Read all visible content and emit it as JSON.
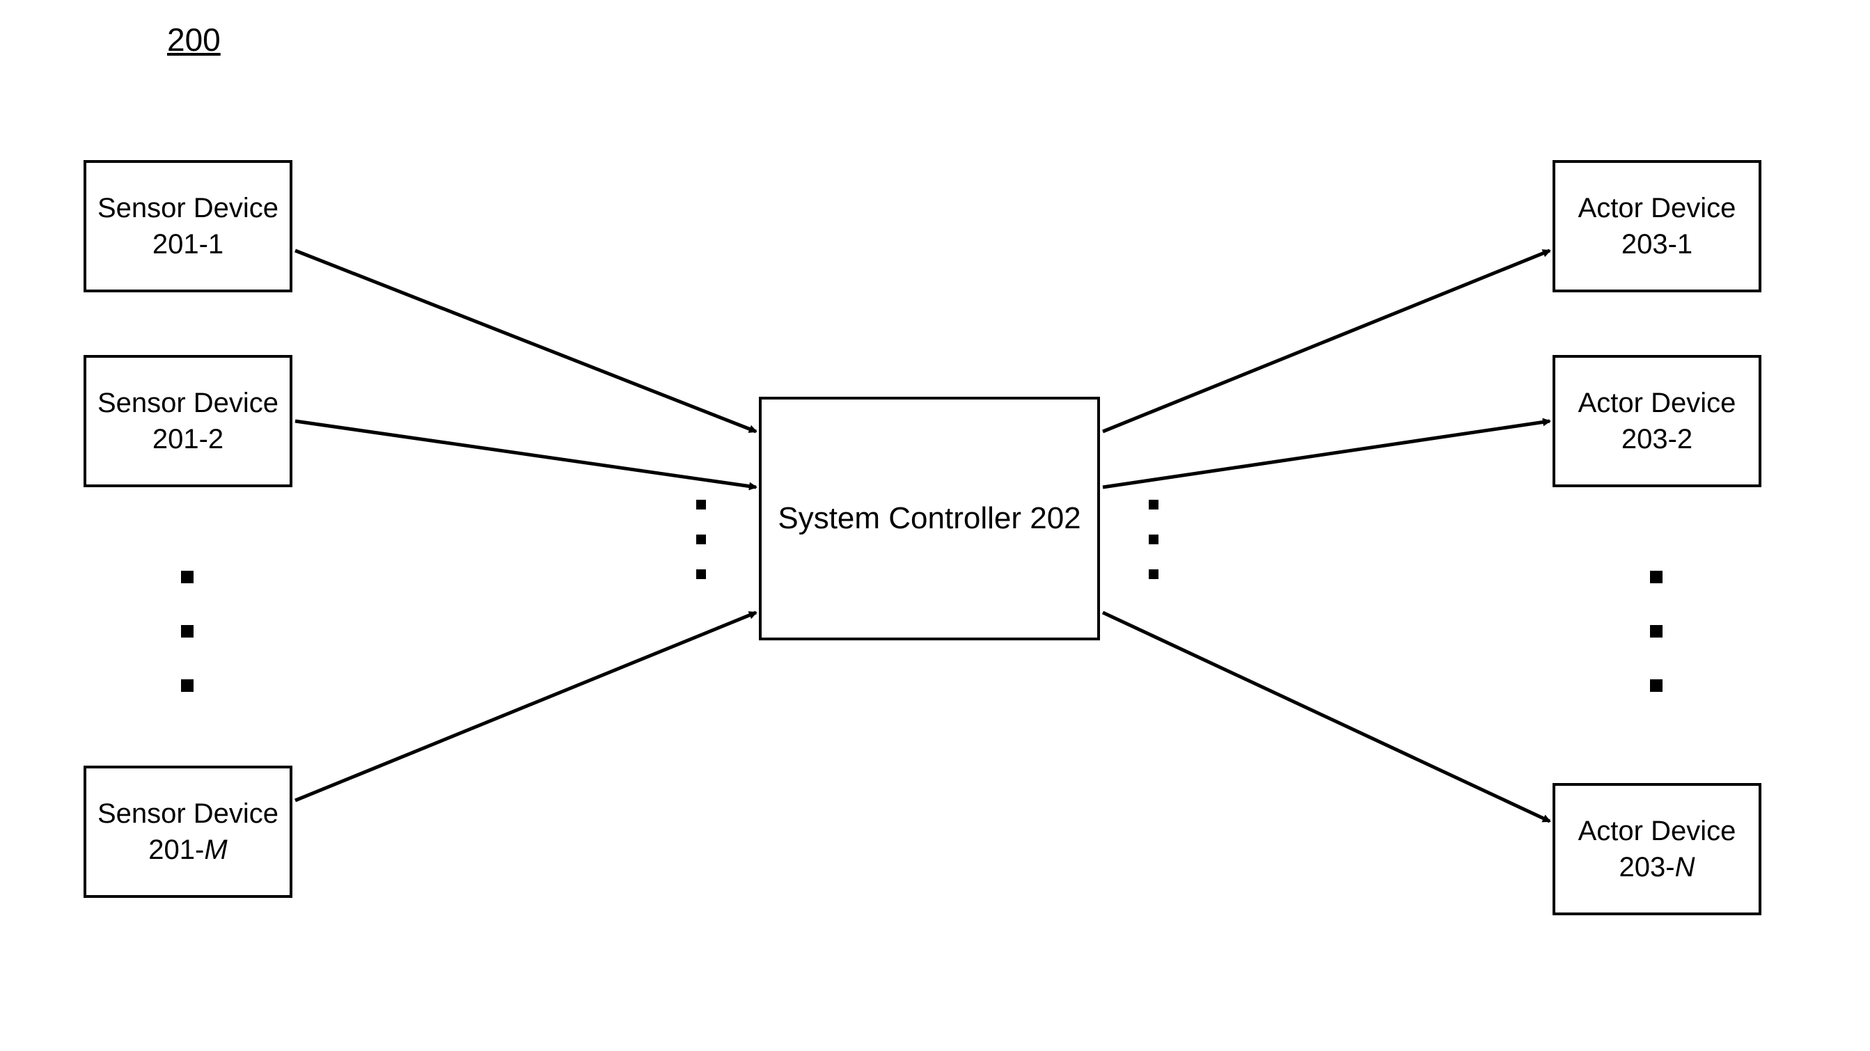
{
  "figure_number": "200",
  "sensors": {
    "box1": {
      "line1": "Sensor Device",
      "id_prefix": "201-",
      "id_var": "1"
    },
    "box2": {
      "line1": "Sensor Device",
      "id_prefix": "201-",
      "id_var": "2"
    },
    "boxM": {
      "line1": "Sensor Device",
      "id_prefix": "201-",
      "id_var": "M"
    }
  },
  "controller": {
    "line1": "System Controller 202"
  },
  "actors": {
    "box1": {
      "line1": "Actor Device",
      "id_prefix": "203-",
      "id_var": "1"
    },
    "box2": {
      "line1": "Actor Device",
      "id_prefix": "203-",
      "id_var": "2"
    },
    "boxN": {
      "line1": "Actor Device",
      "id_prefix": "203-",
      "id_var": "N"
    }
  }
}
